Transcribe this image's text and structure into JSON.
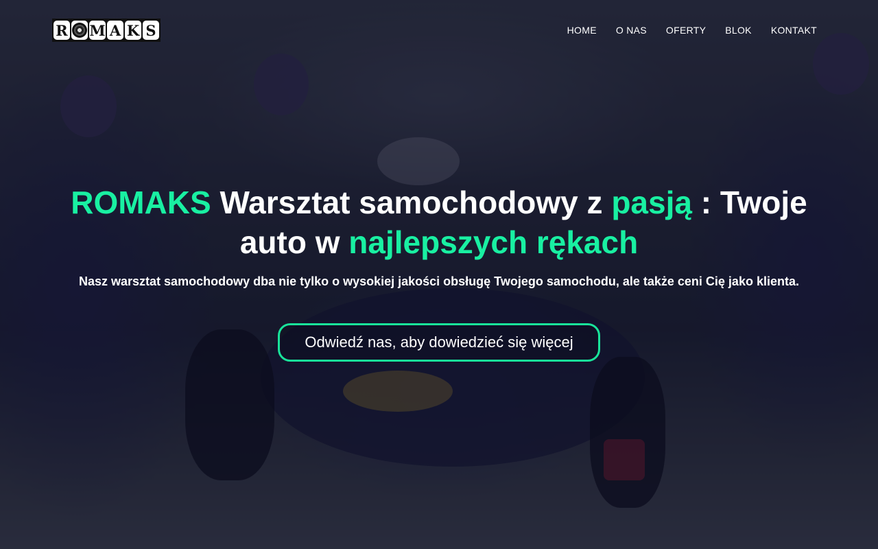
{
  "header": {
    "logo": {
      "letters": [
        "R",
        "",
        "M",
        "A",
        "K",
        "S"
      ],
      "text": "ROMAKS"
    },
    "nav": [
      {
        "label": "HOME"
      },
      {
        "label": "O NAS"
      },
      {
        "label": "OFERTY"
      },
      {
        "label": "BLOK"
      },
      {
        "label": "KONTAKT"
      }
    ]
  },
  "hero": {
    "title_parts": {
      "brand": "ROMAKS",
      "p1": " Warsztat samochodowy z ",
      "passion": "pasją",
      "p2": " : Twoje auto w ",
      "hands": "najlepszych rękach"
    },
    "subtitle": "Nasz warsztat samochodowy dba nie tylko o wysokiej jakości obsługę Twojego samochodu, ale także ceni Cię jako klienta.",
    "cta_label": "Odwiedź nas, aby dowiedzieć się więcej"
  },
  "colors": {
    "accent": "#19f0a2",
    "cta_border": "#19e39a",
    "overlay": "#0e1028"
  }
}
